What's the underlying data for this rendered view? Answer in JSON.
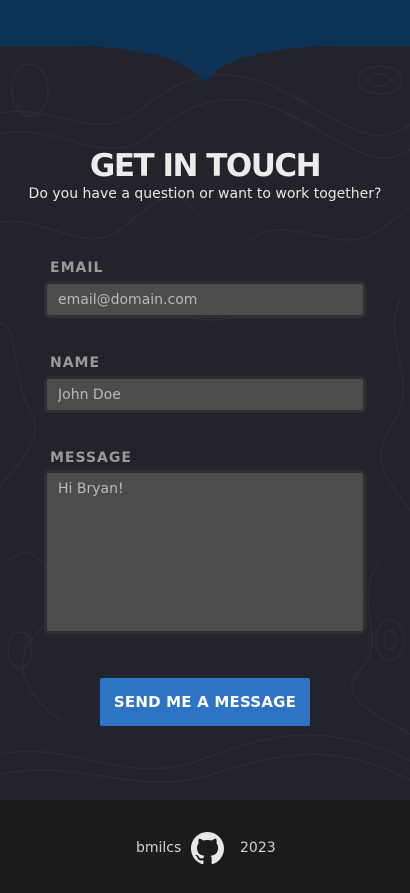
{
  "contact": {
    "heading": "GET IN TOUCH",
    "subheading": "Do you have a question or want to work together?"
  },
  "form": {
    "email_label": "EMAIL",
    "email_placeholder": "email@domain.com",
    "name_label": "NAME",
    "name_placeholder": "John Doe",
    "message_label": "MESSAGE",
    "message_placeholder": "Hi Bryan!",
    "submit_label": "SEND ME A MESSAGE"
  },
  "footer": {
    "username": "bmilcs",
    "year": "2023",
    "social_icon": "github-icon"
  },
  "colors": {
    "background": "#23242b",
    "top_band": "#0d3258",
    "input_background": "#4c4c4c",
    "button": "#2d74c5",
    "footer": "#1c1c1e"
  }
}
